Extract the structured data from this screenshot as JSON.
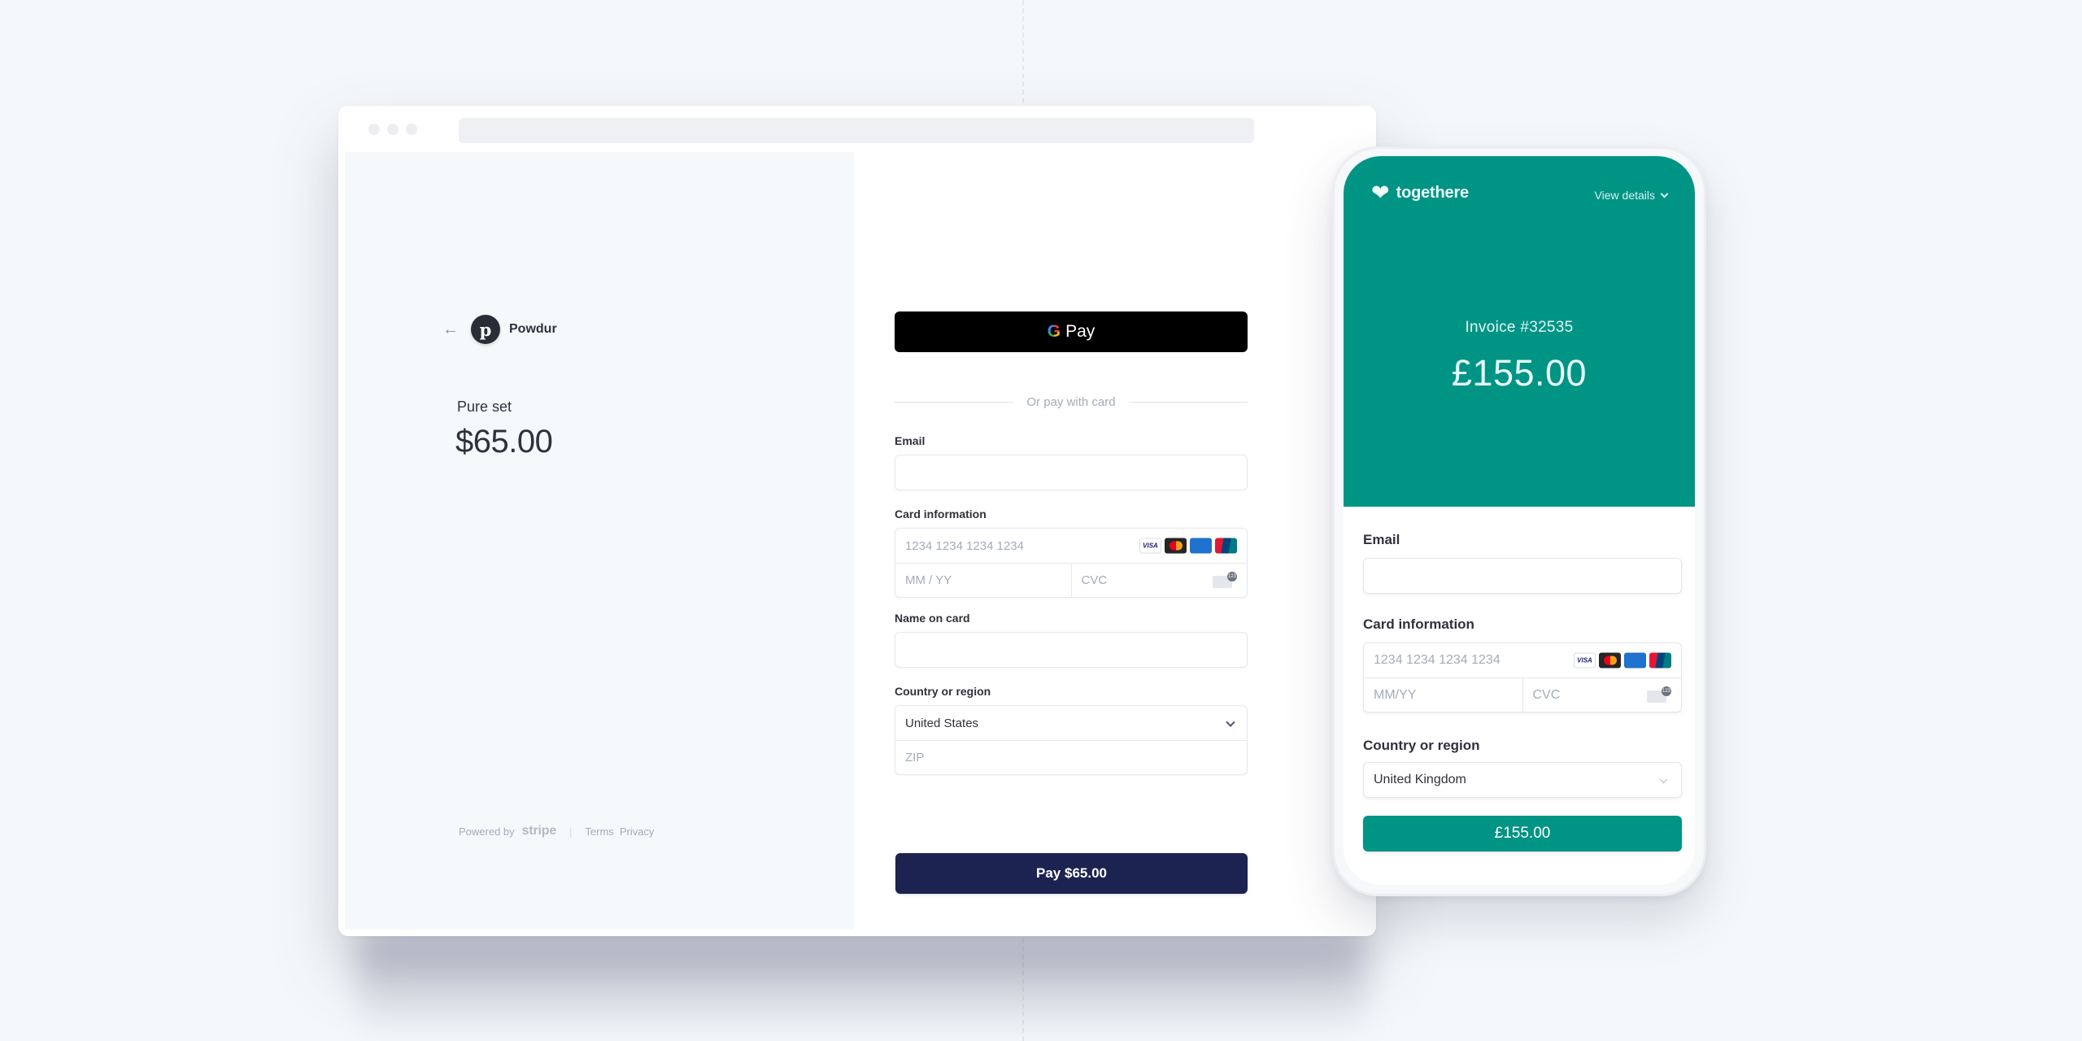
{
  "desktop": {
    "merchant": {
      "back_icon": "arrow-left-icon",
      "logo_letter": "p",
      "name": "Powdur"
    },
    "product": {
      "name": "Pure set",
      "price": "$65.00"
    },
    "footer": {
      "powered_by": "Powered by",
      "brand": "stripe",
      "separator": "|",
      "terms": "Terms",
      "privacy": "Privacy"
    },
    "form": {
      "gpay": {
        "g": "G",
        "label": "Pay"
      },
      "divider_text": "Or pay with card",
      "email": {
        "label": "Email",
        "value": "",
        "placeholder": ""
      },
      "card": {
        "label": "Card information",
        "number_placeholder": "1234 1234 1234 1234",
        "expiry_placeholder": "MM / YY",
        "cvc_placeholder": "CVC",
        "brands": [
          "VISA",
          "Mastercard",
          "AMEX",
          "UnionPay"
        ]
      },
      "name": {
        "label": "Name on card",
        "value": ""
      },
      "country": {
        "label": "Country or region",
        "value": "United States",
        "zip_placeholder": "ZIP"
      },
      "pay_button": "Pay $65.00"
    },
    "colors": {
      "pay_button": "#1c2350",
      "gpay": "#000000"
    }
  },
  "mobile": {
    "brand": {
      "icon": "heart-logo-icon",
      "name": "togethere"
    },
    "view_details": "View details",
    "invoice_title": "Invoice #32535",
    "invoice_amount": "£155.00",
    "email": {
      "label": "Email",
      "value": ""
    },
    "card": {
      "label": "Card information",
      "number_placeholder": "1234 1234 1234 1234",
      "expiry_placeholder": "MM/YY",
      "cvc_placeholder": "CVC",
      "brands": [
        "VISA",
        "Mastercard",
        "AMEX",
        "UnionPay"
      ]
    },
    "country": {
      "label": "Country or region",
      "value": "United Kingdom"
    },
    "pay_button": "£155.00",
    "colors": {
      "accent": "#009485"
    }
  }
}
